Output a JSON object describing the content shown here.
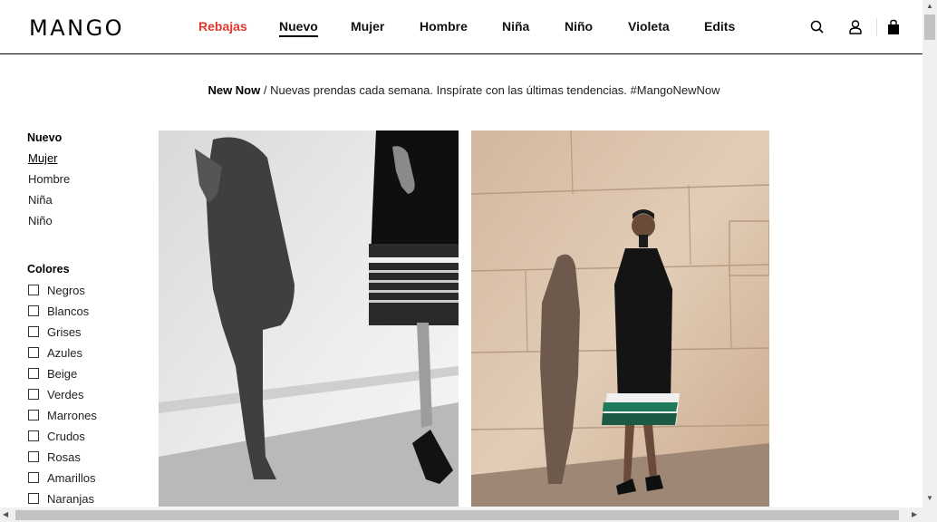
{
  "header": {
    "logo": "MANGO",
    "nav": [
      {
        "label": "Rebajas"
      },
      {
        "label": "Nuevo"
      },
      {
        "label": "Mujer"
      },
      {
        "label": "Hombre"
      },
      {
        "label": "Niña"
      },
      {
        "label": "Niño"
      },
      {
        "label": "Violeta"
      },
      {
        "label": "Edits"
      }
    ],
    "icons": [
      "search-icon",
      "user-icon",
      "bag-icon"
    ]
  },
  "tagline": {
    "bold": "New Now",
    "text": " / Nuevas prendas cada semana. Inspírate con las últimas tendencias. #MangoNewNow"
  },
  "sidebar": {
    "section_title": "Nuevo",
    "links": [
      {
        "label": "Mujer"
      },
      {
        "label": "Hombre"
      },
      {
        "label": "Niña"
      },
      {
        "label": "Niño"
      }
    ],
    "colors_title": "Colores",
    "colors": [
      {
        "label": "Negros"
      },
      {
        "label": "Blancos"
      },
      {
        "label": "Grises"
      },
      {
        "label": "Azules"
      },
      {
        "label": "Beige"
      },
      {
        "label": "Verdes"
      },
      {
        "label": "Marrones"
      },
      {
        "label": "Crudos"
      },
      {
        "label": "Rosas"
      },
      {
        "label": "Amarillos"
      },
      {
        "label": "Naranjas"
      }
    ]
  },
  "theme": {
    "sale_color": "#e0362c",
    "text_color": "#000000"
  }
}
